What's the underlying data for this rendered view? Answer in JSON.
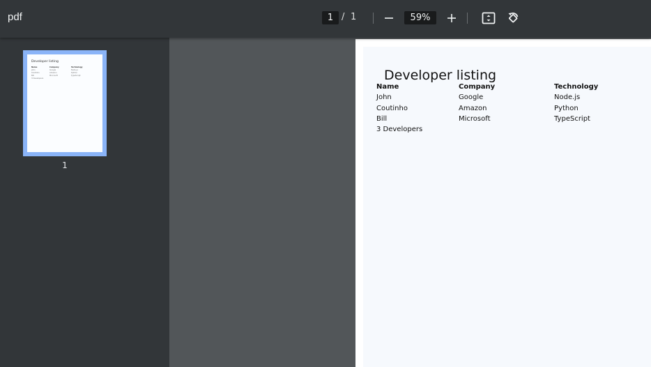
{
  "toolbar": {
    "title": "pdf",
    "current_page": "1",
    "page_separator": "/",
    "total_pages": "1",
    "zoom": "59%",
    "icons": [
      "zoom-out-icon",
      "zoom-in-icon",
      "fit-page-icon",
      "rotate-icon"
    ]
  },
  "sidebar": {
    "thumbnails": [
      {
        "label": "1"
      }
    ]
  },
  "document": {
    "title": "Developer listing",
    "columns": [
      "Name",
      "Company",
      "Technology"
    ],
    "rows": [
      [
        "John",
        "Google",
        "Node.js"
      ],
      [
        "Coutinho",
        "Amazon",
        "Python"
      ],
      [
        "Bill",
        "Microsoft",
        "TypeScript"
      ]
    ],
    "footer": "3 Developers"
  },
  "colors": {
    "toolbar_bg": "#323639",
    "viewer_bg": "#525659",
    "thumbnail_highlight": "#8ab4f8"
  }
}
